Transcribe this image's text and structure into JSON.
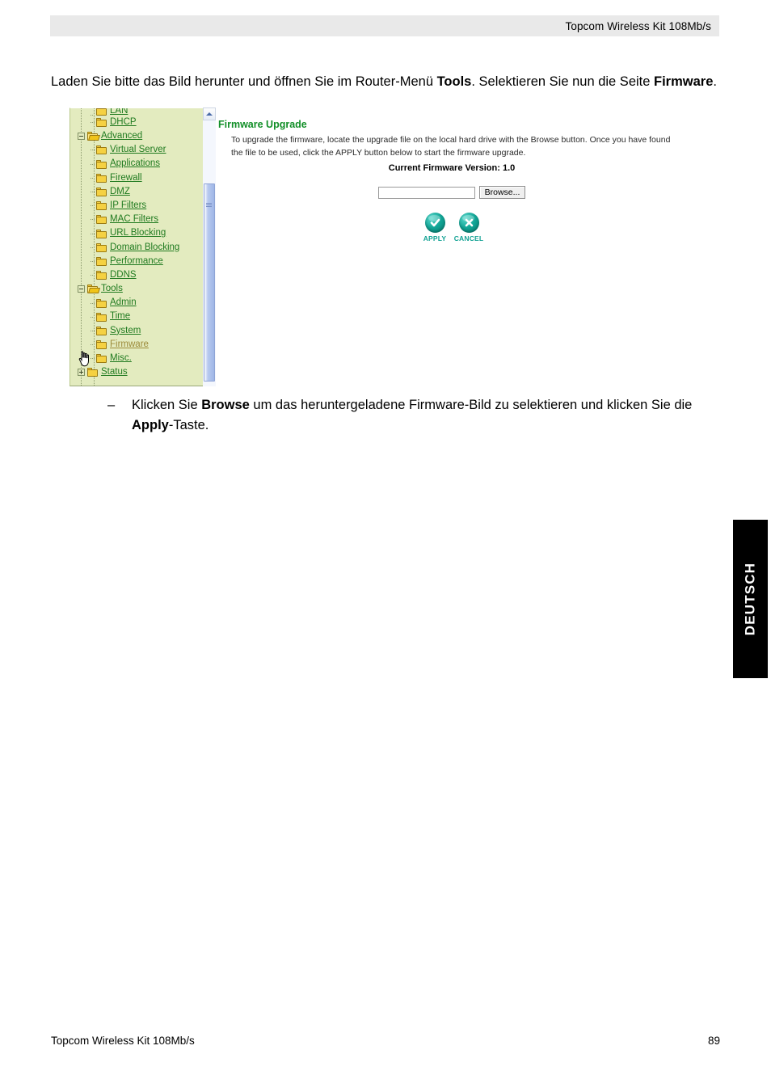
{
  "header": {
    "title": "Topcom Wireless Kit 108Mb/s"
  },
  "intro": {
    "part1": "Laden Sie bitte das Bild herunter und öffnen Sie im Router-Menü ",
    "bold1": "Tools",
    "part2": ". Selektieren Sie nun die Seite ",
    "bold2": "Firmware",
    "part3": "."
  },
  "screenshot": {
    "sidebar": {
      "items": [
        {
          "label": "LAN",
          "level": 2,
          "node": "none",
          "folder": "closed",
          "state": "clipped"
        },
        {
          "label": "DHCP",
          "level": 2,
          "node": "none",
          "folder": "closed",
          "state": "normal"
        },
        {
          "label": "Advanced",
          "level": 1,
          "node": "minus",
          "folder": "open",
          "state": "normal"
        },
        {
          "label": "Virtual Server",
          "level": 2,
          "node": "none",
          "folder": "closed",
          "state": "normal"
        },
        {
          "label": "Applications",
          "level": 2,
          "node": "none",
          "folder": "closed",
          "state": "normal"
        },
        {
          "label": "Firewall",
          "level": 2,
          "node": "none",
          "folder": "closed",
          "state": "normal"
        },
        {
          "label": "DMZ",
          "level": 2,
          "node": "none",
          "folder": "closed",
          "state": "normal"
        },
        {
          "label": "IP Filters",
          "level": 2,
          "node": "none",
          "folder": "closed",
          "state": "normal"
        },
        {
          "label": "MAC Filters",
          "level": 2,
          "node": "none",
          "folder": "closed",
          "state": "normal"
        },
        {
          "label": "URL Blocking",
          "level": 2,
          "node": "none",
          "folder": "closed",
          "state": "normal"
        },
        {
          "label": "Domain Blocking",
          "level": 2,
          "node": "none",
          "folder": "closed",
          "state": "normal"
        },
        {
          "label": "Performance",
          "level": 2,
          "node": "none",
          "folder": "closed",
          "state": "normal"
        },
        {
          "label": "DDNS",
          "level": 2,
          "node": "none",
          "folder": "closed",
          "state": "normal"
        },
        {
          "label": "Tools",
          "level": 1,
          "node": "minus",
          "folder": "open",
          "state": "normal"
        },
        {
          "label": "Admin",
          "level": 2,
          "node": "none",
          "folder": "closed",
          "state": "normal"
        },
        {
          "label": "Time",
          "level": 2,
          "node": "none",
          "folder": "closed",
          "state": "normal"
        },
        {
          "label": "System",
          "level": 2,
          "node": "none",
          "folder": "closed",
          "state": "normal"
        },
        {
          "label": "Firmware",
          "level": 2,
          "node": "none",
          "folder": "closed",
          "state": "hovered"
        },
        {
          "label": "Misc.",
          "level": 2,
          "node": "none",
          "folder": "closed",
          "state": "normal"
        },
        {
          "label": "Status",
          "level": 1,
          "node": "plus",
          "folder": "closed",
          "state": "normal"
        }
      ]
    },
    "content": {
      "heading": "Firmware Upgrade",
      "description": "To upgrade the firmware, locate the upgrade file on the local hard drive with the Browse button. Once you have found the file to be used, click the APPLY button below to start the firmware upgrade.",
      "current_version_label": "Current Firmware Version: 1.0",
      "file_input_value": "",
      "file_input_placeholder": "",
      "browse_label": "Browse...",
      "apply_label": "APPLY",
      "cancel_label": "CANCEL",
      "accent_color": "#12a596",
      "heading_color": "#128f28"
    }
  },
  "bullet": {
    "dash": "–",
    "part1": "Klicken Sie ",
    "bold1": "Browse",
    "part2": " um das heruntergeladene Firmware-Bild zu selektieren und klicken Sie die ",
    "bold2": "Apply",
    "part3": "-Taste."
  },
  "language_tab": {
    "label": "DEUTSCH"
  },
  "footer": {
    "left": "Topcom Wireless Kit 108Mb/s",
    "page": "89"
  }
}
